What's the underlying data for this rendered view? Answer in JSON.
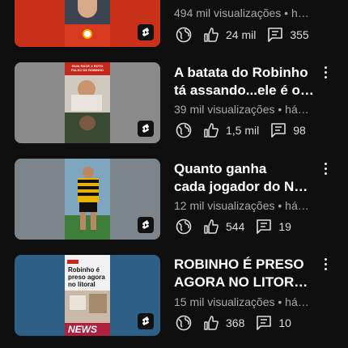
{
  "videos": [
    {
      "title_line1": "",
      "title_line2": "",
      "meta": "494 mil visualizações • h…",
      "likes": "24 mil",
      "comments": "355",
      "thumb_bg": "#d2341c",
      "inner_text": ""
    },
    {
      "title_line1": "A batata do Robinho",
      "title_line2": "tá assando...ele é o p…",
      "meta": "39 mil visualizações • há…",
      "likes": "1,5 mil",
      "comments": "98",
      "thumb_bg": "#8a8a8a",
      "inner_text": "GUIA RÁCE X ROTO FALSO DE ROBINHO"
    },
    {
      "title_line1": "Quanto ganha",
      "title_line2": "cada jogador do Nov…",
      "meta": "12 mil visualizações • há…",
      "likes": "544",
      "comments": "19",
      "thumb_bg": "#7d858c",
      "inner_text": ""
    },
    {
      "title_line1": "ROBINHO É PRESO",
      "title_line2": "AGORA NO LITORAL …",
      "meta": "15 mil visualizações • há…",
      "likes": "368",
      "comments": "10",
      "thumb_bg": "#2e5f86",
      "inner_text": "Robinho é preso agora no litoral",
      "inner_tag": "NEWS"
    }
  ],
  "icons": {
    "globe": "globe-icon",
    "like": "thumbs-up-icon",
    "comment": "comment-icon",
    "shorts": "shorts-icon",
    "more": "more-vert-icon"
  }
}
